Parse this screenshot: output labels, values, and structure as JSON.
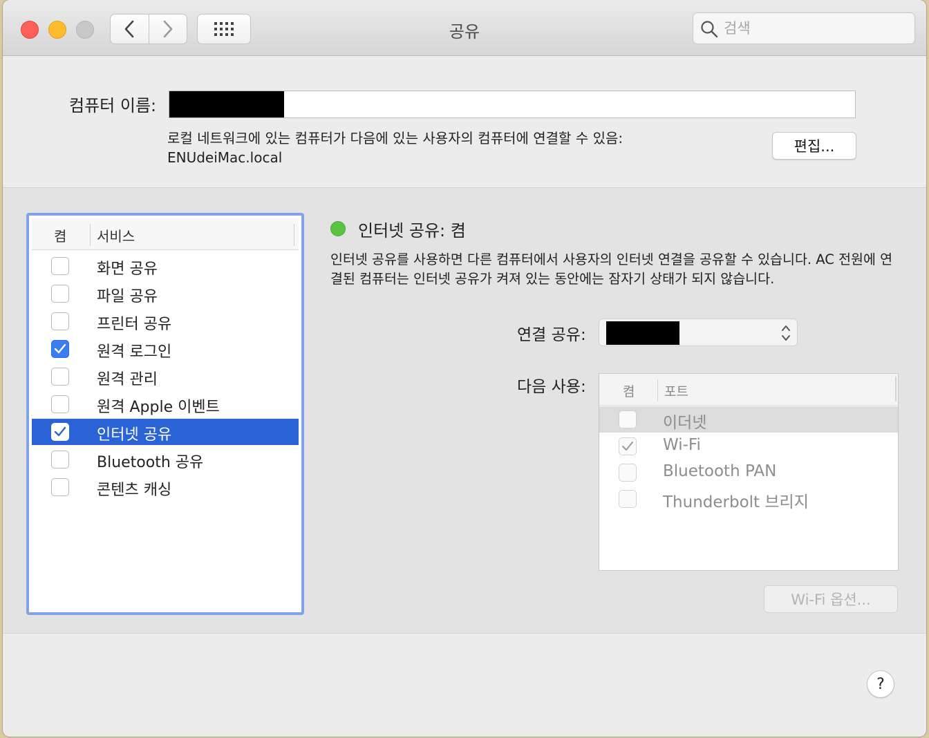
{
  "window": {
    "title": "공유"
  },
  "toolbar": {
    "back_icon": "chevron-left-icon",
    "forward_icon": "chevron-right-icon",
    "grid_icon": "grid-icon"
  },
  "search": {
    "placeholder": "검색",
    "icon": "search-icon"
  },
  "computer_name": {
    "label": "컴퓨터 이름:",
    "value": "",
    "redacted": true,
    "local_network_text": "로컬 네트워크에 있는 컴퓨터가 다음에 있는 사용자의 컴퓨터에 연결할 수 있음:",
    "hostname": "ENUdeiMac.local",
    "edit_label": "편집..."
  },
  "services": {
    "header_on": "켬",
    "header_service": "서비스",
    "items": [
      {
        "label": "화면 공유",
        "checked": false,
        "selected": false
      },
      {
        "label": "파일 공유",
        "checked": false,
        "selected": false
      },
      {
        "label": "프린터 공유",
        "checked": false,
        "selected": false
      },
      {
        "label": "원격 로그인",
        "checked": true,
        "selected": false
      },
      {
        "label": "원격 관리",
        "checked": false,
        "selected": false
      },
      {
        "label": "원격 Apple 이벤트",
        "checked": false,
        "selected": false
      },
      {
        "label": "인터넷 공유",
        "checked": true,
        "selected": true
      },
      {
        "label": "Bluetooth 공유",
        "checked": false,
        "selected": false
      },
      {
        "label": "콘텐츠 캐싱",
        "checked": false,
        "selected": false
      }
    ]
  },
  "detail": {
    "status_title": "인터넷 공유: 켬",
    "status_color": "#5ac440",
    "description": "인터넷 공유를 사용하면 다른 컴퓨터에서 사용자의 인터넷 연결을 공유할 수 있습니다. AC 전원에 연결된 컴퓨터는 인터넷 공유가 켜져 있는 동안에는 잠자기 상태가 되지 않습니다.",
    "share_from_label": "연결 공유:",
    "share_from_value": "",
    "share_from_redacted": true,
    "to_label": "다음 사용:",
    "ports_header_on": "켬",
    "ports_header_port": "포트",
    "ports": [
      {
        "label": "이더넷",
        "checked": false,
        "highlighted": true
      },
      {
        "label": "Wi-Fi",
        "checked": true,
        "highlighted": false
      },
      {
        "label": "Bluetooth PAN",
        "checked": false,
        "highlighted": false
      },
      {
        "label": "Thunderbolt 브리지",
        "checked": false,
        "highlighted": false
      }
    ],
    "wifi_options_label": "Wi-Fi 옵션..."
  },
  "help": {
    "label": "?"
  },
  "colors": {
    "accent": "#2a63d6",
    "checkbox_blue": "#3b7cf1"
  }
}
